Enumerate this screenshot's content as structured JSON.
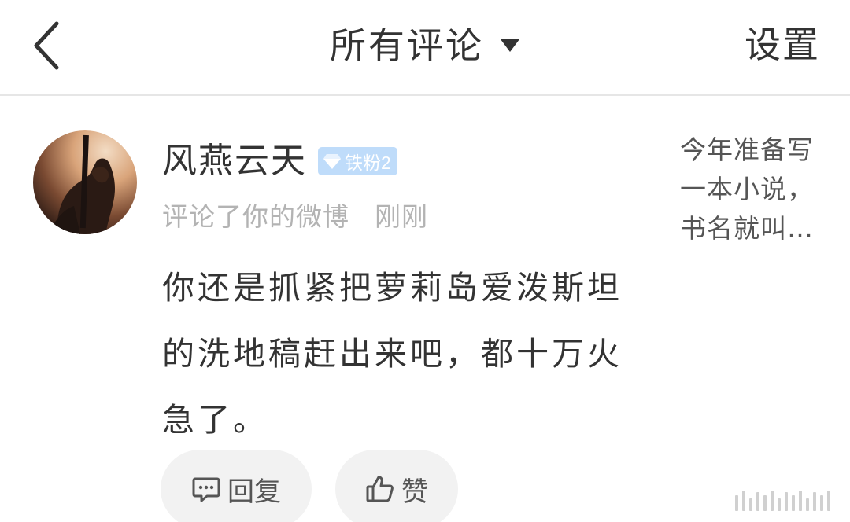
{
  "header": {
    "title": "所有评论",
    "settings_label": "设置"
  },
  "icons": {
    "back": "chevron-left-icon",
    "title_dropdown": "triangle-down-icon",
    "badge": "diamond-icon",
    "reply": "comment-bubble-icon",
    "like": "thumbs-up-icon"
  },
  "comment": {
    "username": "风燕云天",
    "badge_label": "铁粉2",
    "action_text": "评论了你的微博",
    "time": "刚刚",
    "text_lines": [
      "你还是抓紧把萝莉岛爱泼斯坦",
      "的洗地稿赶出来吧，都十万火",
      "急了。"
    ],
    "post_preview_lines": [
      "今年准备写",
      "一本小说，",
      "书名就叫…"
    ]
  },
  "actions": {
    "reply_label": "回复",
    "like_label": "赞"
  },
  "colors": {
    "badge_bg": "#bfdcfa",
    "muted_text": "#b3b3b3",
    "button_bg": "#f2f2f2",
    "divider": "#e6e6e6"
  }
}
